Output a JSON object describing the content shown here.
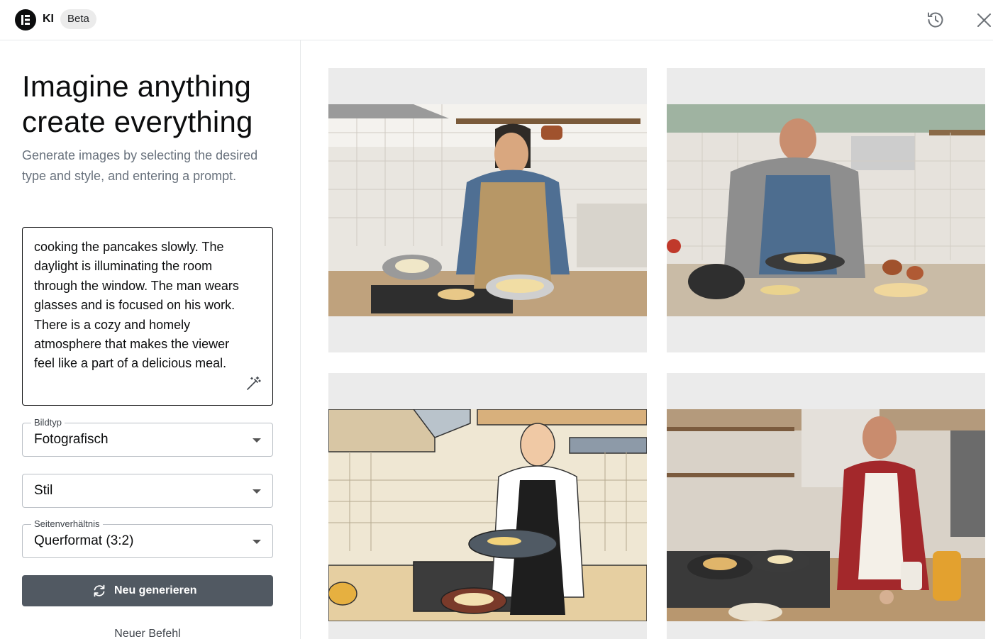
{
  "header": {
    "app_name": "KI",
    "badge": "Beta",
    "logo_icon": "elementor-logo-icon",
    "history_icon": "history-icon",
    "close_icon": "close-icon"
  },
  "panel": {
    "heading_line1": "Imagine anything",
    "heading_line2": "create everything",
    "subtitle": "Generate images by selecting the desired type and style, and entering a prompt.",
    "prompt": "cooking the pancakes slowly. The daylight is illuminating the room through the window. The man wears glasses and is focused on his work. There is a cozy and homely atmosphere that makes the viewer feel like a part of a delicious meal.",
    "enhance_icon": "magic-wand-icon"
  },
  "selects": {
    "image_type": {
      "label": "Bildtyp",
      "value": "Fotografisch"
    },
    "style": {
      "label": "",
      "value": "Stil"
    },
    "ratio": {
      "label": "Seitenverhältnis",
      "value": "Querformat (3:2)"
    }
  },
  "actions": {
    "regenerate": "Neu generieren",
    "regenerate_icon": "refresh-icon",
    "new_command": "Neuer Befehl"
  },
  "colors": {
    "primary_text": "#0c0d0e",
    "secondary_text": "#69727d",
    "button_bg": "#515962",
    "card_bg": "#ebebeb"
  }
}
